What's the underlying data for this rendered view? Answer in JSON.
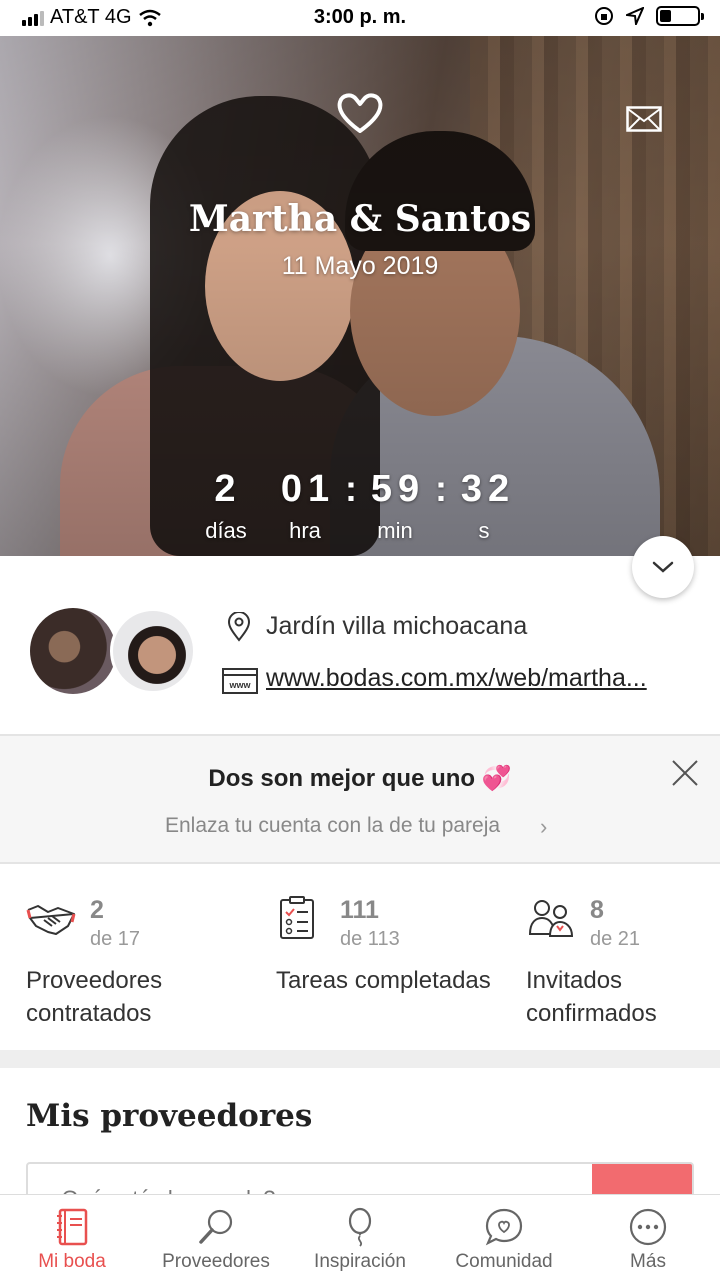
{
  "status_bar": {
    "carrier": "AT&T 4G",
    "time": "3:00 p. m."
  },
  "hero": {
    "couple_name": "Martha & Santos",
    "date": "11 Mayo 2019",
    "countdown": {
      "days": "2",
      "days_label": "días",
      "hours": "01",
      "hours_label": "hra",
      "minutes": "59",
      "minutes_label": "min",
      "seconds": "32",
      "seconds_label": "s"
    }
  },
  "info": {
    "location": "Jardín villa michoacana",
    "website": "www.bodas.com.mx/web/martha..."
  },
  "banner": {
    "title": "Dos son mejor que uno",
    "emoji": "💞",
    "subtitle": "Enlaza tu cuenta con la de tu pareja",
    "chevron": "›"
  },
  "stats": [
    {
      "icon": "handshake-icon",
      "value": "2",
      "of": "de 17",
      "label": "Proveedores contratados"
    },
    {
      "icon": "checklist-icon",
      "value": "111",
      "of": "de 113",
      "label": "Tareas completadas"
    },
    {
      "icon": "guests-icon",
      "value": "8",
      "of": "de 21",
      "label": "Invitados confirmados"
    }
  ],
  "providers": {
    "title": "Mis proveedores",
    "search_placeholder": "¿Qué estás buscando?"
  },
  "tabs": [
    {
      "label": "Mi boda",
      "icon": "notebook-icon",
      "active": true
    },
    {
      "label": "Proveedores",
      "icon": "magnifier-icon",
      "active": false
    },
    {
      "label": "Inspiración",
      "icon": "balloon-icon",
      "active": false
    },
    {
      "label": "Comunidad",
      "icon": "chat-heart-icon",
      "active": false
    },
    {
      "label": "Más",
      "icon": "more-icon",
      "active": false
    }
  ],
  "colors": {
    "accent": "#e8504f",
    "search_button": "#f26b6f"
  }
}
